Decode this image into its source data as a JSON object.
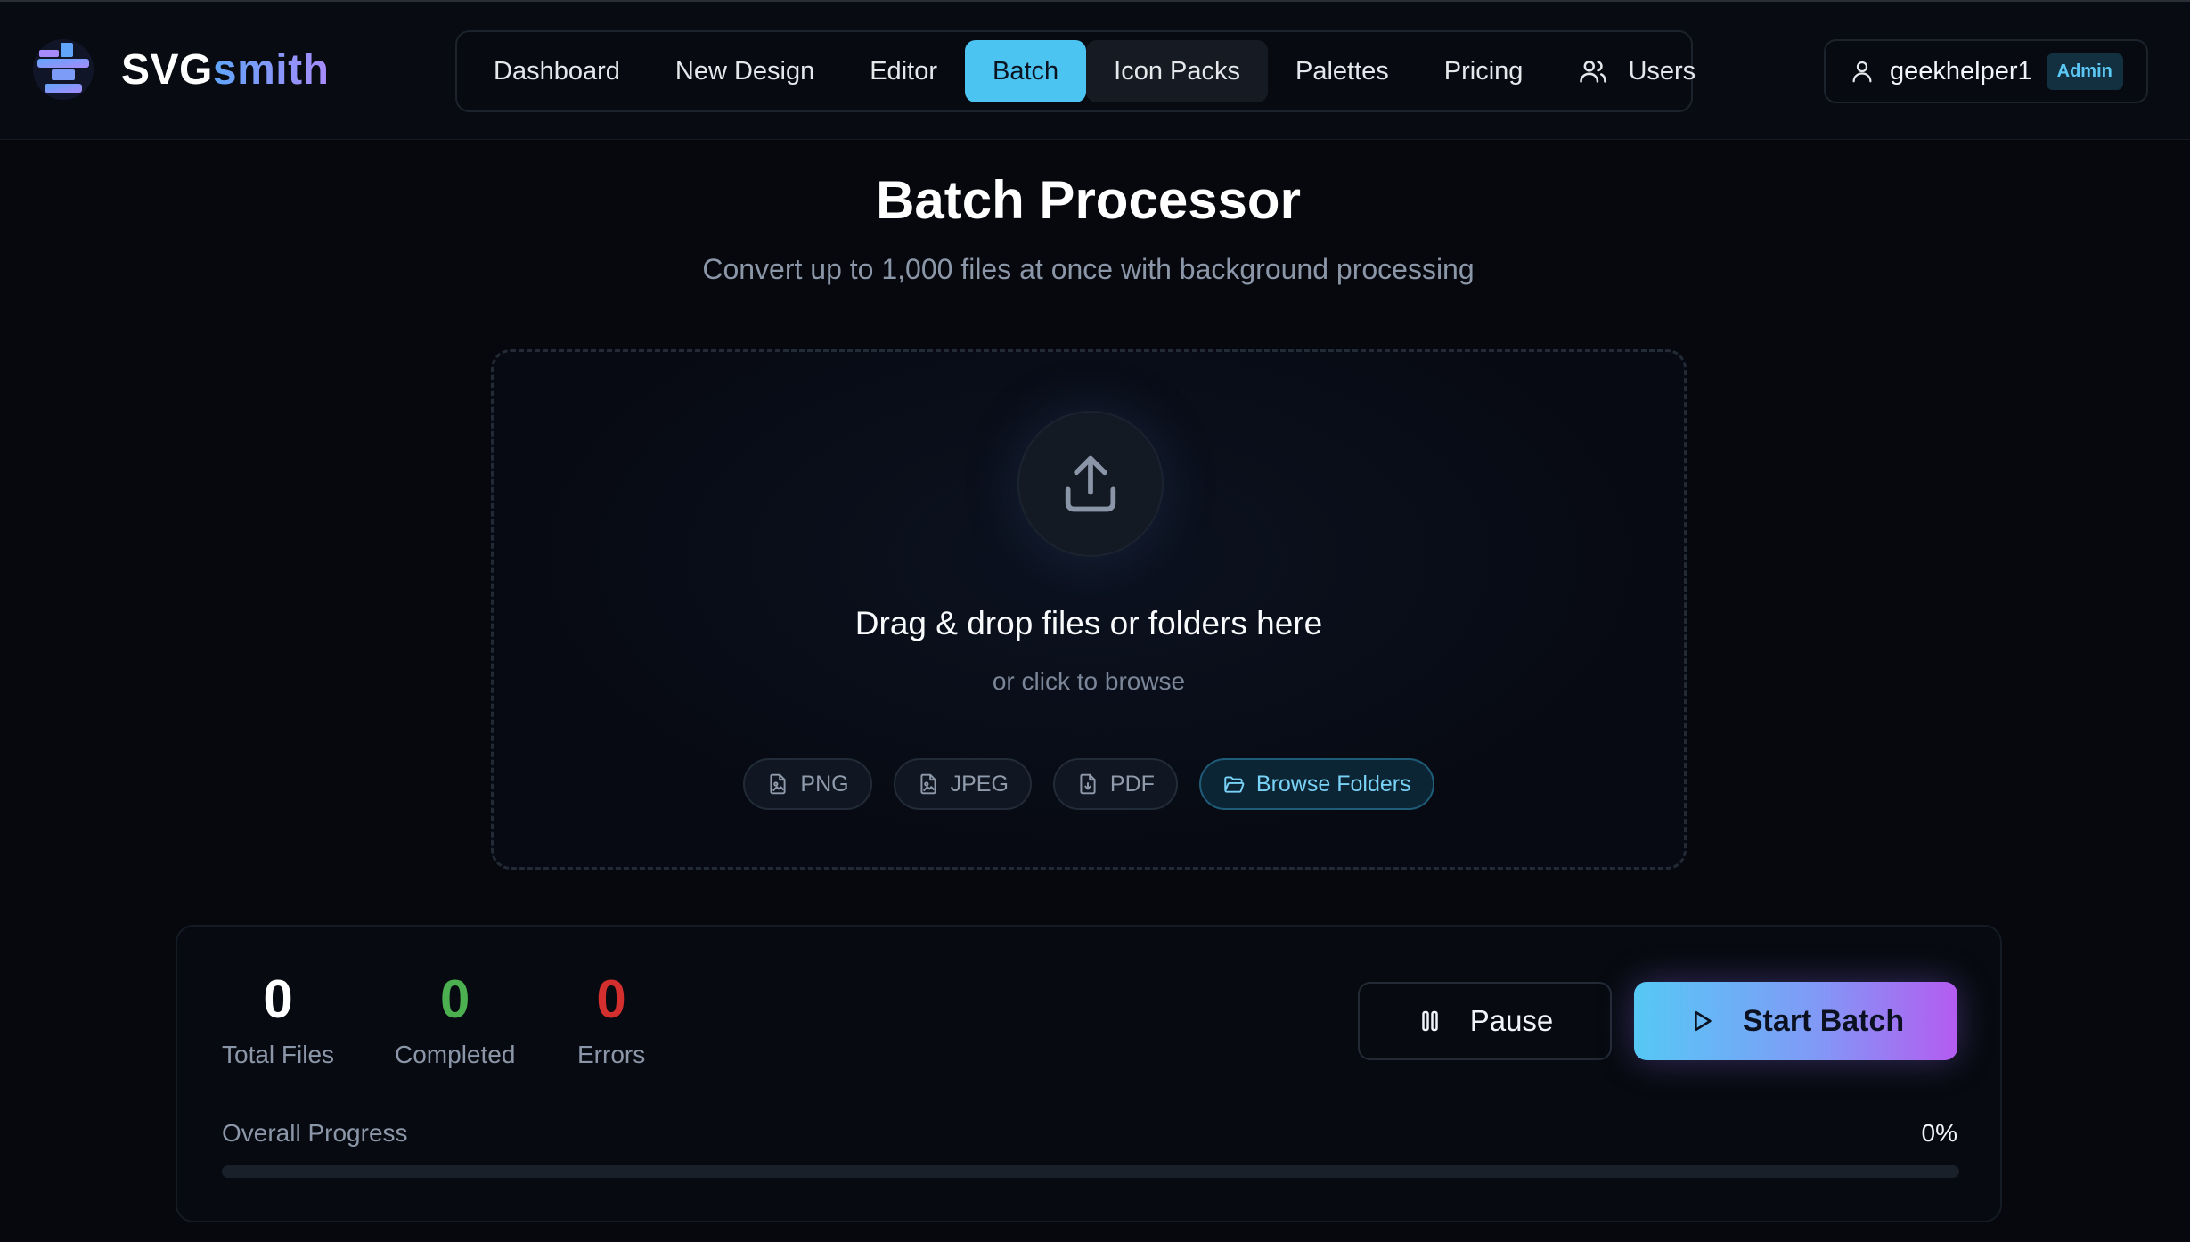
{
  "brand": {
    "name_part1": "SVG",
    "name_part2": "smith",
    "logo_icon": "anvil-icon"
  },
  "nav": {
    "items": [
      {
        "label": "Dashboard"
      },
      {
        "label": "New Design"
      },
      {
        "label": "Editor"
      },
      {
        "label": "Batch",
        "active": true
      },
      {
        "label": "Icon Packs"
      },
      {
        "label": "Palettes"
      },
      {
        "label": "Pricing"
      },
      {
        "label": "Users",
        "icon": "users-icon"
      }
    ]
  },
  "user": {
    "name": "geekhelper1",
    "role_badge": "Admin",
    "icon": "user-icon"
  },
  "page": {
    "title": "Batch Processor",
    "subtitle": "Convert up to 1,000 files at once with background processing"
  },
  "dropzone": {
    "icon": "upload-icon",
    "title": "Drag & drop files or folders here",
    "subtitle": "or click to browse",
    "formats": [
      {
        "label": "PNG",
        "icon": "file-image-icon"
      },
      {
        "label": "JPEG",
        "icon": "file-image-icon"
      },
      {
        "label": "PDF",
        "icon": "file-text-icon"
      }
    ],
    "browse_label": "Browse Folders",
    "browse_icon": "folder-open-icon"
  },
  "stats": {
    "total": {
      "value": "0",
      "label": "Total Files",
      "color": "#ffffff"
    },
    "completed": {
      "value": "0",
      "label": "Completed",
      "color": "#4caf50"
    },
    "errors": {
      "value": "0",
      "label": "Errors",
      "color": "#d32f2f"
    }
  },
  "actions": {
    "pause_label": "Pause",
    "start_label": "Start Batch"
  },
  "progress": {
    "label": "Overall Progress",
    "percent_text": "0%",
    "value": 0
  },
  "colors": {
    "accent": "#4cc4f2",
    "gradient_start": "#56c8f5",
    "gradient_end": "#b45cf0",
    "background": "#06080d"
  }
}
